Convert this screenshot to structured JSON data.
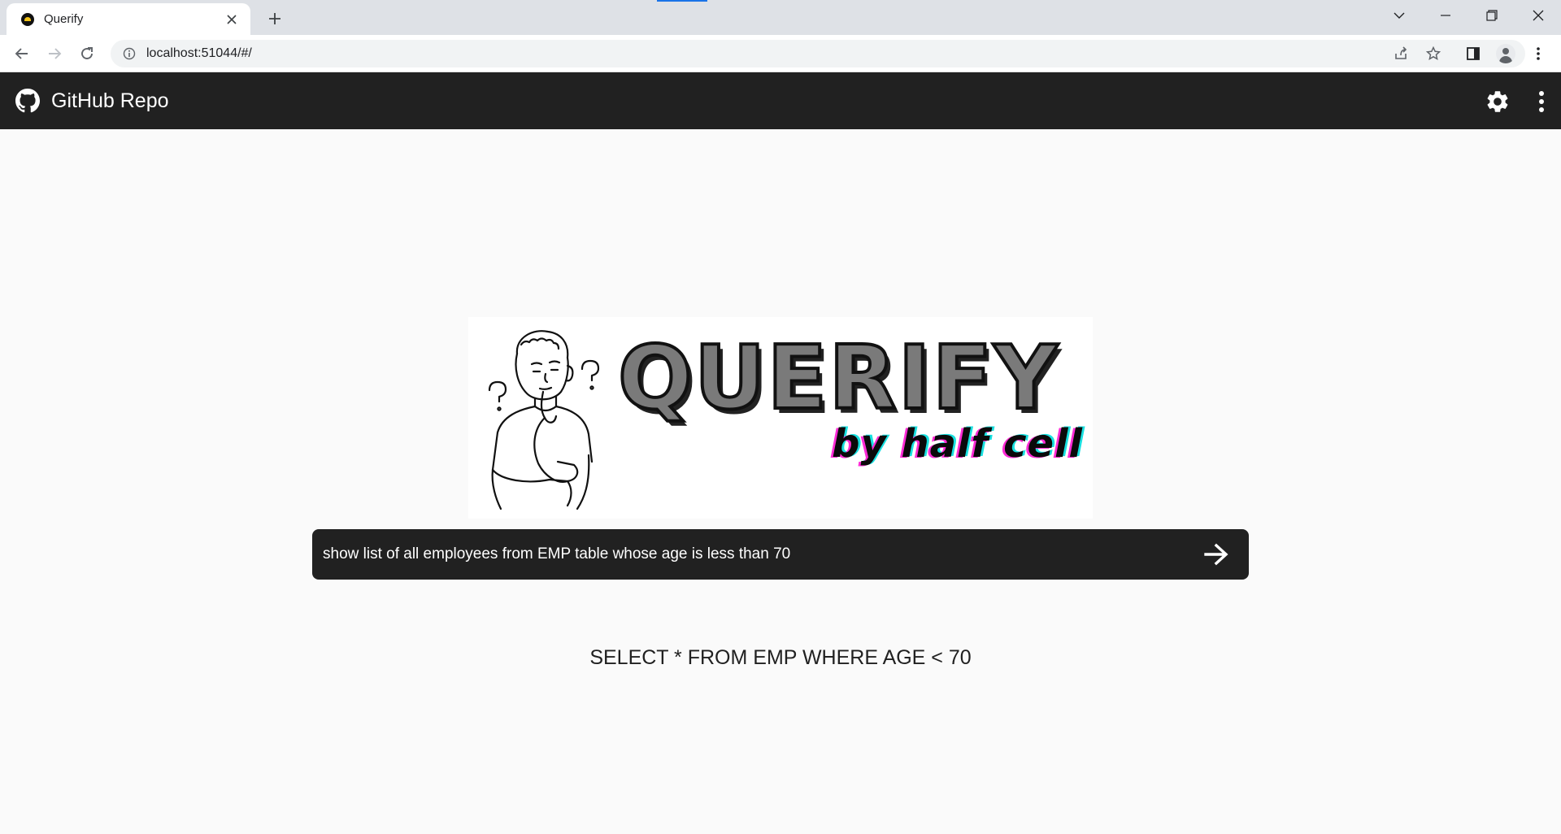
{
  "browser": {
    "tab_title": "Querify",
    "url": "localhost:51044/#/",
    "accent": "#1a73e8"
  },
  "appbar": {
    "github_label": "GitHub Repo",
    "background": "#212121",
    "icons": [
      "github-icon",
      "gear-icon",
      "more-vert-icon"
    ]
  },
  "logo": {
    "title": "QUERIFY",
    "subtitle": "by half cell"
  },
  "query": {
    "value": "show list of all employees from EMP table whose age is less than 70",
    "submit_icon": "arrow-right-icon"
  },
  "result": {
    "sql": "SELECT * FROM EMP WHERE AGE < 70"
  }
}
